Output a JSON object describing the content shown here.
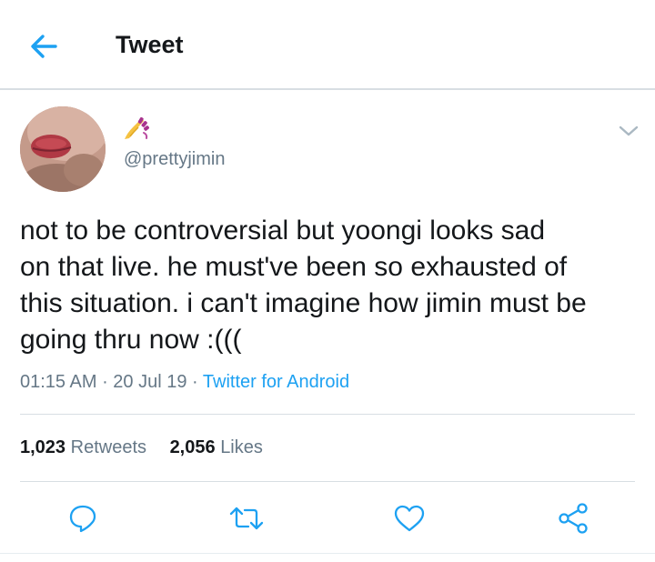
{
  "header": {
    "title": "Tweet"
  },
  "user": {
    "display_name_emoji": "💅",
    "handle": "@prettyjimin"
  },
  "tweet": {
    "text_lines": [
      "not to be controversial but yoongi looks sad",
      "on that live. he must've been so exhausted of",
      "this situation. i can't imagine how jimin must be",
      "going thru now :((("
    ],
    "time": "01:15 AM",
    "date": "20 Jul 19",
    "separator": " · ",
    "source": "Twitter for Android"
  },
  "stats": {
    "retweets_count": "1,023",
    "retweets_label": "Retweets",
    "likes_count": "2,056",
    "likes_label": "Likes"
  },
  "icons": {
    "back": "arrow-left-icon",
    "caret": "chevron-down-icon",
    "reply": "speech-bubble-icon",
    "retweet": "retweet-icon",
    "like": "heart-icon",
    "share": "share-icon"
  },
  "colors": {
    "accent": "#1da1f2",
    "text": "#14171a",
    "secondary": "#657786",
    "divider": "#d8dee3"
  }
}
